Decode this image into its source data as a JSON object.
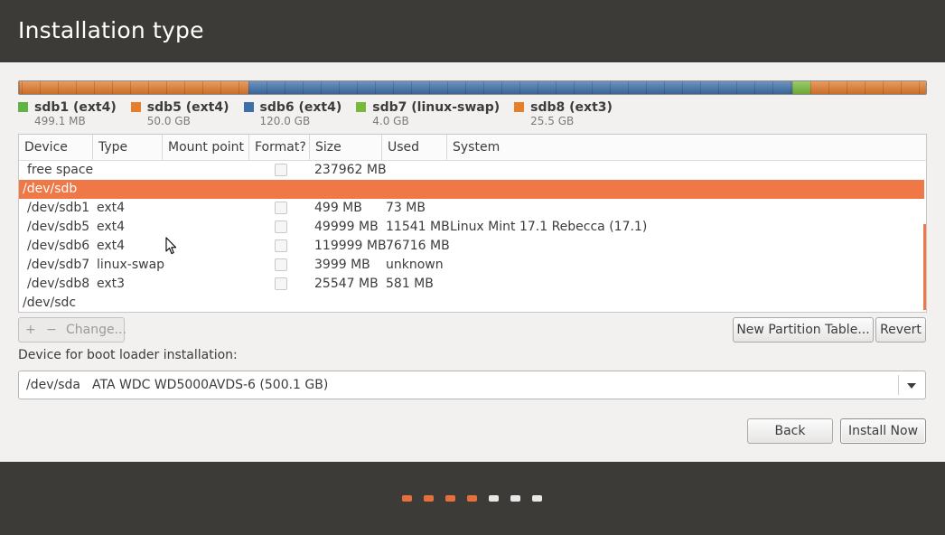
{
  "window": {
    "title": "Installation type"
  },
  "partition_bar": [
    {
      "name": "sdb1",
      "color": "#e07a2c",
      "gb": 0.499
    },
    {
      "name": "sdb5",
      "color": "#e07a2c",
      "gb": 50.0
    },
    {
      "name": "sdb6",
      "color": "#3f6fa8",
      "gb": 120.0
    },
    {
      "name": "sdb7",
      "color": "#79b83a",
      "gb": 4.0
    },
    {
      "name": "sdb8",
      "color": "#e07a2c",
      "gb": 25.5
    }
  ],
  "legend": [
    {
      "label": "sdb1 (ext4)",
      "size": "499.1 MB",
      "color": "#62b346"
    },
    {
      "label": "sdb5 (ext4)",
      "size": "50.0 GB",
      "color": "#e77f2a"
    },
    {
      "label": "sdb6 (ext4)",
      "size": "120.0 GB",
      "color": "#3f6fa8"
    },
    {
      "label": "sdb7 (linux-swap)",
      "size": "4.0 GB",
      "color": "#79b83a"
    },
    {
      "label": "sdb8 (ext3)",
      "size": "25.5 GB",
      "color": "#e77f2a"
    }
  ],
  "table": {
    "headers": [
      "Device",
      "Type",
      "Mount point",
      "Format?",
      "Size",
      "Used",
      "System"
    ],
    "rows": [
      {
        "device": "free space",
        "type": "",
        "mount": "",
        "format": true,
        "size": "237962 MB",
        "used": "",
        "system": ""
      },
      {
        "device": "/dev/sdb",
        "type": "",
        "mount": "",
        "format": false,
        "size": "",
        "used": "",
        "system": "",
        "selected": true,
        "parent": true
      },
      {
        "device": "/dev/sdb1",
        "type": "ext4",
        "mount": "",
        "format": true,
        "size": "499 MB",
        "used": "73 MB",
        "system": ""
      },
      {
        "device": "/dev/sdb5",
        "type": "ext4",
        "mount": "",
        "format": true,
        "size": "49999 MB",
        "used": "11541 MB",
        "system": "Linux Mint 17.1 Rebecca (17.1)"
      },
      {
        "device": "/dev/sdb6",
        "type": "ext4",
        "mount": "",
        "format": true,
        "size": "119999 MB",
        "used": "76716 MB",
        "system": ""
      },
      {
        "device": "/dev/sdb7",
        "type": "linux-swap",
        "mount": "",
        "format": true,
        "size": "3999 MB",
        "used": "unknown",
        "system": ""
      },
      {
        "device": "/dev/sdb8",
        "type": "ext3",
        "mount": "",
        "format": true,
        "size": "25547 MB",
        "used": "581 MB",
        "system": ""
      },
      {
        "device": "/dev/sdc",
        "type": "",
        "mount": "",
        "format": false,
        "size": "",
        "used": "",
        "system": "",
        "parent": true
      }
    ]
  },
  "toolbar": {
    "add_label": "+",
    "remove_label": "−",
    "change_label": "Change...",
    "new_table_label": "New Partition Table...",
    "revert_label": "Revert"
  },
  "boot": {
    "label": "Device for boot loader installation:",
    "device": "/dev/sda",
    "description": "ATA WDC WD5000AVDS-6 (500.1 GB)"
  },
  "buttons": {
    "back": "Back",
    "install": "Install Now"
  },
  "progress": {
    "total_steps": 7,
    "completed_steps": 4,
    "done_color": "#e6703b",
    "todo_color": "#e8e8e8"
  }
}
